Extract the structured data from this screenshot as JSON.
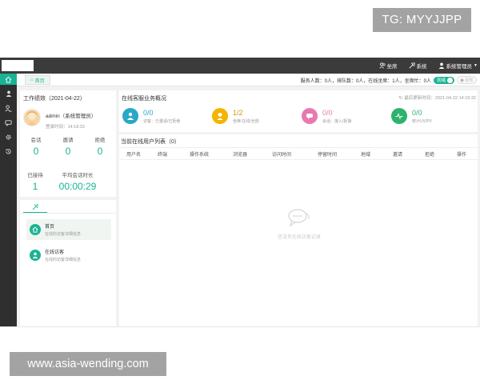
{
  "watermarks": {
    "top": "TG: MYYJJPP",
    "bottom": "www.asia-wending.com"
  },
  "topbar": {
    "menu": [
      {
        "label": "坐席",
        "icon": "users-icon"
      },
      {
        "label": "系统",
        "icon": "tools-icon"
      },
      {
        "label": "系统管理员",
        "icon": "user-icon"
      }
    ]
  },
  "leftnav": {
    "items": [
      {
        "icon": "home-icon",
        "active": true
      },
      {
        "icon": "user-icon"
      },
      {
        "icon": "users-icon"
      },
      {
        "icon": "chat-icon"
      },
      {
        "icon": "gear-icon"
      },
      {
        "icon": "history-icon"
      }
    ]
  },
  "tabs": {
    "home": "首页"
  },
  "service_info": {
    "text": "服务人数：0人，排队数：0人，在线坐席：1人，坐席忙：0人",
    "toggle_label": "就绪",
    "busy_label": "示忙"
  },
  "work": {
    "title": "工作绩效（2021-04-22）",
    "admin_name": "admin（系统管理员）",
    "login_time": "登录时间：14:18:33",
    "stats": [
      {
        "label": "会话",
        "value": "0"
      },
      {
        "label": "邀请",
        "value": "0"
      },
      {
        "label": "拒绝",
        "value": "0"
      }
    ],
    "stats2": [
      {
        "label": "已接待",
        "value": "1"
      },
      {
        "label": "平均会话时长",
        "value": "00:00:29"
      }
    ]
  },
  "quick": {
    "items": [
      {
        "title": "首页",
        "sub": "在线的访客详细信息",
        "active": true
      },
      {
        "title": "在线访客",
        "sub": "在线的访客详细信息",
        "active": false
      }
    ]
  },
  "overview": {
    "title": "在线客服业务概况",
    "update": "最后更新时间：2021-04-22 14:19:32",
    "metrics": [
      {
        "value": "0/0",
        "label": "访客：已邀请/已拒绝",
        "color": "#2aa7c9",
        "icon": "person-icon"
      },
      {
        "value": "1/2",
        "label": "坐席:在线/全部",
        "color": "#f4b400",
        "icon": "agent-icon"
      },
      {
        "value": "0/0",
        "label": "会话：接入/拒接",
        "color": "#e879b0",
        "icon": "chat-bubble-icon"
      },
      {
        "value": "0/0",
        "label": "统计UV/PV",
        "color": "#2db36b",
        "icon": "pulse-icon"
      }
    ]
  },
  "list": {
    "title": "当前在线用户列表（0）",
    "columns": [
      "用户名",
      "终端",
      "操作系统",
      "浏览器",
      "访问时间",
      "停留时间",
      "地域",
      "邀请",
      "拒绝",
      "操作"
    ],
    "empty": "还没有在线访客记录"
  }
}
